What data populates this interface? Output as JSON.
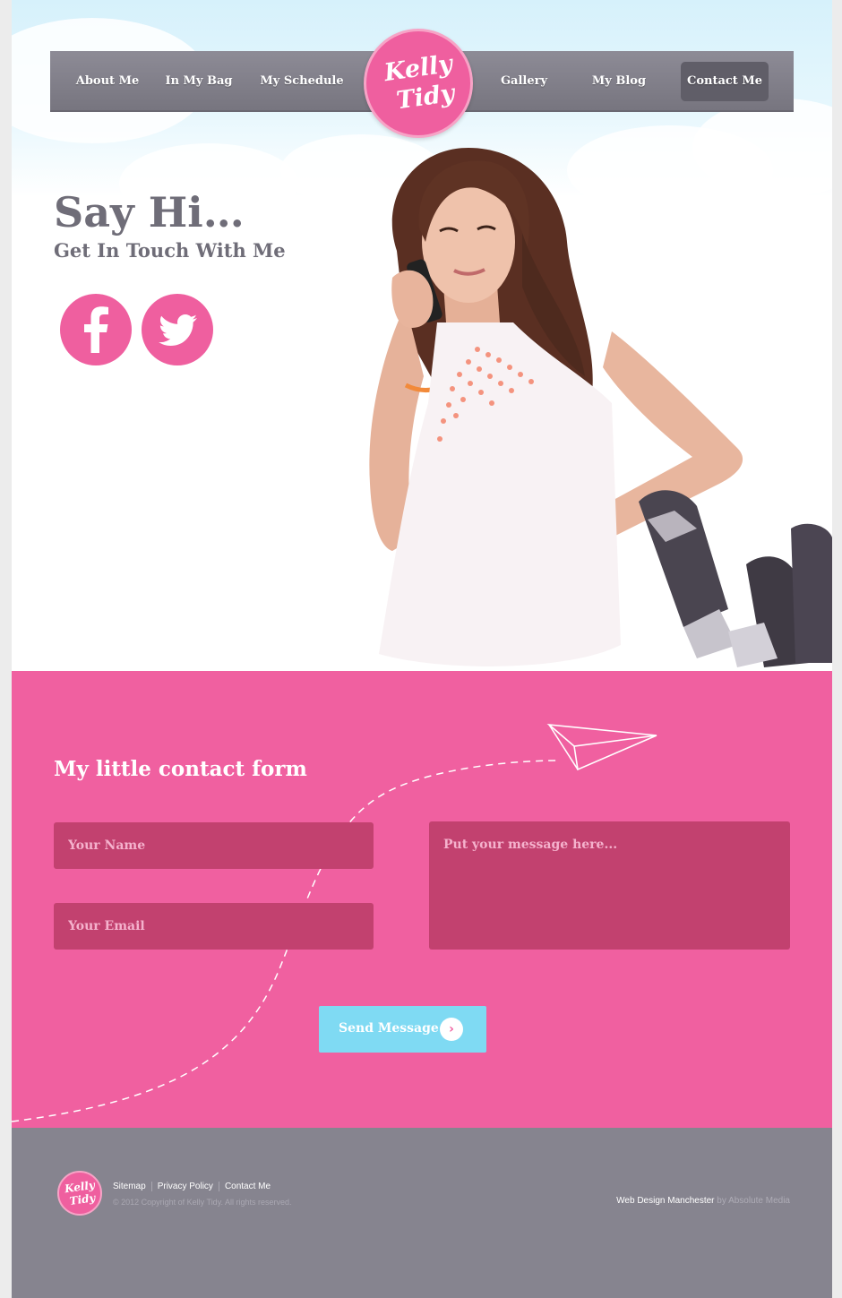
{
  "colors": {
    "brand_pink": "#f060a0",
    "field_pink": "#c2416f",
    "nav_grey": "#807e89",
    "footer_grey": "#86848f",
    "button_blue": "#7fdaf3",
    "heading_grey": "#6f6d78"
  },
  "nav": {
    "items": [
      {
        "label": "About Me"
      },
      {
        "label": "In My Bag"
      },
      {
        "label": "My Schedule"
      },
      {
        "label": "Gallery"
      },
      {
        "label": "My Blog"
      },
      {
        "label": "Contact Me",
        "active": true
      }
    ]
  },
  "logo": {
    "line1": "Kelly",
    "line2": "Tidy"
  },
  "hero": {
    "title": "Say Hi…",
    "subtitle": "Get In Touch With Me",
    "social": [
      {
        "icon": "facebook-icon",
        "glyph": "f"
      },
      {
        "icon": "twitter-icon"
      }
    ]
  },
  "contact": {
    "title": "My little contact form",
    "name_placeholder": "Your Name",
    "email_placeholder": "Your Email",
    "message_placeholder": "Put your message here...",
    "send_label": "Send Message",
    "send_icon": "arrow-right-icon"
  },
  "footer": {
    "logo_line1": "Kelly",
    "logo_line2": "Tidy",
    "links": [
      "Sitemap",
      "Privacy Policy",
      "Contact Me"
    ],
    "copyright": "© 2012 Copyright of Kelly Tidy. All rights reserved.",
    "credit_text": "Web Design Manchester",
    "credit_by": "by",
    "credit_company": "Absolute Media"
  }
}
